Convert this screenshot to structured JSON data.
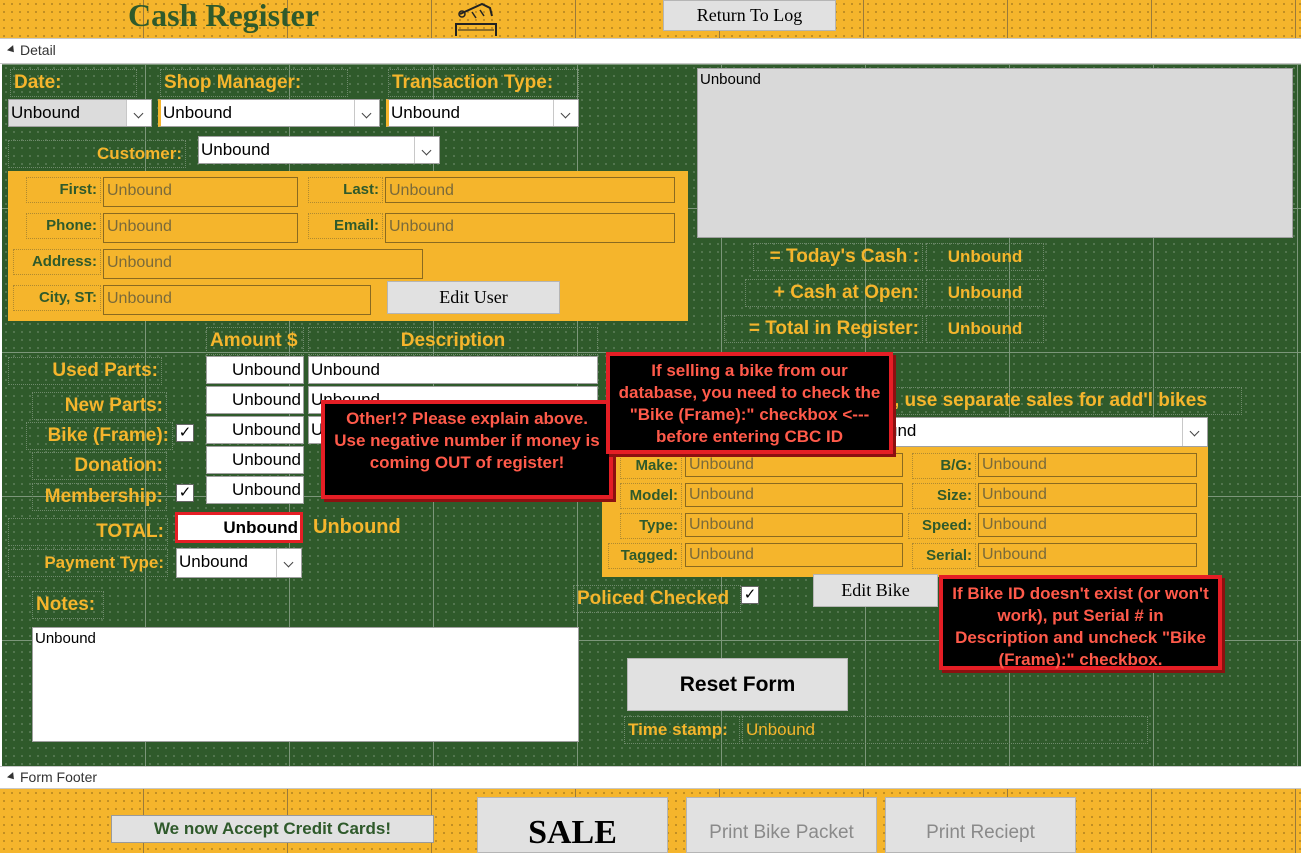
{
  "header": {
    "title": "Cash Register",
    "return_button": "Return To Log"
  },
  "sections": {
    "detail": "Detail",
    "footer": "Form Footer"
  },
  "left": {
    "date_label": "Date:",
    "date_value": "Unbound",
    "manager_label": "Shop Manager:",
    "manager_value": "Unbound",
    "transaction_label": "Transaction Type:",
    "transaction_value": "Unbound",
    "customer_label": "Customer:",
    "customer_value": "Unbound",
    "first_label": "First:",
    "first_value": "Unbound",
    "last_label": "Last:",
    "last_value": "Unbound",
    "phone_label": "Phone:",
    "phone_value": "Unbound",
    "email_label": "Email:",
    "email_value": "Unbound",
    "address_label": "Address:",
    "address_value": "Unbound",
    "city_label": "City, ST:",
    "city_value": "Unbound",
    "edit_user_button": "Edit User",
    "amount_header": "Amount $",
    "description_header": "Description",
    "used_parts_label": "Used Parts:",
    "new_parts_label": "New Parts:",
    "bike_frame_label": "Bike (Frame):",
    "donation_label": "Donation:",
    "membership_label": "Membership:",
    "total_label": "TOTAL:",
    "total_value": "Unbound",
    "total_text": "Unbound",
    "amounts": [
      "Unbound",
      "Unbound",
      "Unbound",
      "Unbound",
      "Unbound"
    ],
    "descriptions": [
      "Unbound",
      "Unbound",
      "U"
    ],
    "bike_frame_checked": "✓",
    "membership_checked": "✓",
    "payment_label": "Payment Type:",
    "payment_value": "Unbound",
    "notes_label": "Notes:",
    "notes_value": "Unbound"
  },
  "right": {
    "log_box": "Unbound",
    "todays_cash_label": "= Today's Cash :",
    "todays_cash_value": "Unbound",
    "cash_open_label": "+ Cash at Open:",
    "cash_open_value": "Unbound",
    "total_register_label": "= Total in Register:",
    "total_register_value": "Unbound",
    "bike_header_text": ", use separate sales for add'l bikes",
    "bike_combo_value": "und",
    "make_label": "Make:",
    "make_value": "Unbound",
    "bg_label": "B/G:",
    "bg_value": "Unbound",
    "model_label": "Model:",
    "model_value": "Unbound",
    "size_label": "Size:",
    "size_value": "Unbound",
    "type_label": "Type:",
    "type_value": "Unbound",
    "speed_label": "Speed:",
    "speed_value": "Unbound",
    "tagged_label": "Tagged:",
    "tagged_value": "Unbound",
    "serial_label": "Serial:",
    "serial_value": "Unbound",
    "policed_label": "Policed Checked",
    "policed_checked": "✓",
    "edit_bike_button": "Edit Bike",
    "reset_button": "Reset Form",
    "timestamp_label": "Time stamp:",
    "timestamp_value": "Unbound"
  },
  "notes": {
    "other_note": "Other!? Please explain above. Use negative number if money is coming OUT of register!",
    "bike_db_note": "If selling a bike from our database, you need to check the \"Bike (Frame):\" checkbox <--- before entering CBC ID",
    "bike_id_note": "If Bike ID doesn't exist (or won't work), put Serial # in Description and uncheck \"Bike (Frame):\" checkbox."
  },
  "footer": {
    "credit_banner": "We now Accept Credit Cards!",
    "sale_button": "SALE",
    "print_packet_button": "Print Bike Packet",
    "print_receipt_button": "Print Reciept"
  },
  "colors": {
    "form_gold": "#f5b52c",
    "detail_green": "#2f5a2b",
    "note_red": "#e51e25"
  }
}
